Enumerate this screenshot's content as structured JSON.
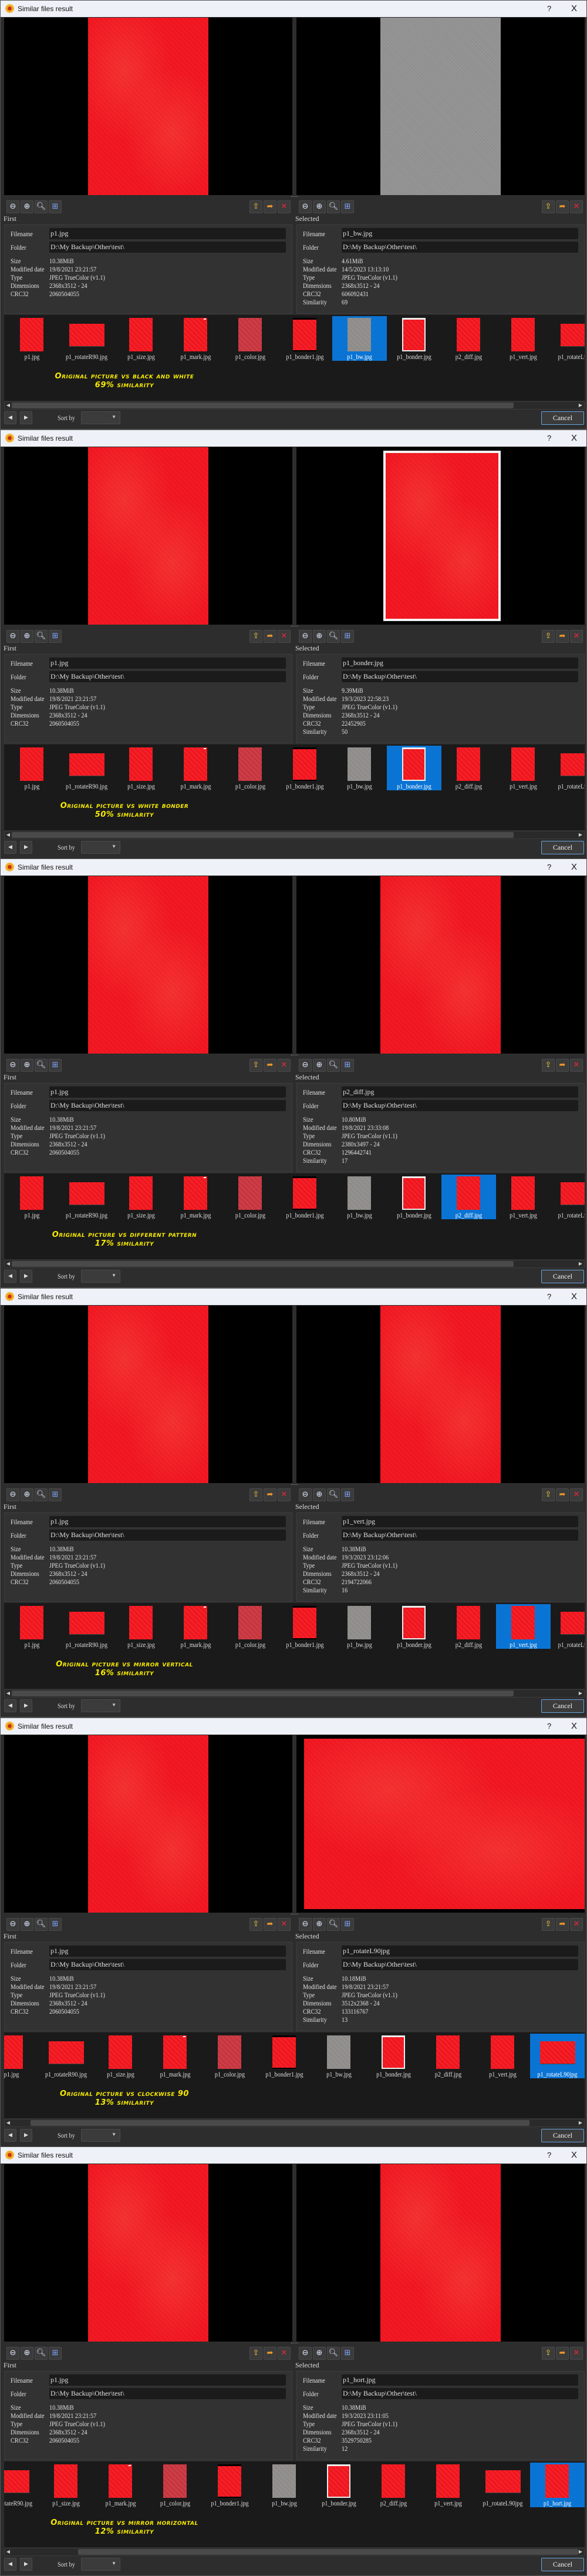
{
  "dialog": {
    "title": "Similar files result",
    "help": "?",
    "close": "X"
  },
  "labels": {
    "first": "First",
    "selected": "Selected",
    "filename": "Filename",
    "folder": "Folder",
    "size": "Size",
    "modified": "Modified date",
    "type": "Type",
    "dimensions": "Dimensions",
    "crc32": "CRC32",
    "similarity": "Similarity",
    "sort_by": "Sort by",
    "cancel": "Cancel"
  },
  "icons": {
    "left_toolbar": [
      "zoom-out-icon",
      "zoom-in-icon",
      "zoom-actual-icon",
      "fit-window-icon"
    ],
    "right_toolbar": [
      "copy-to-folder-icon",
      "move-to-folder-icon",
      "delete-icon"
    ]
  },
  "first_file": {
    "filename": "p1.jpg",
    "folder": "D:\\My Backup\\Other\\test\\",
    "size": "10.38MiB",
    "modified": "19/8/2021 23:21:57",
    "type": "JPEG TrueColor (v1.1)",
    "dimensions": "2368x3512 - 24",
    "crc32": "2060504055"
  },
  "thumbnails": [
    "p1.jpg",
    "p1_rotateR90.jpg",
    "p1_size.jpg",
    "p1_mark.jpg",
    "p1_color.jpg",
    "p1_bonder1.jpg",
    "p1_bw.jpg",
    "p1_bonder.jpg",
    "p2_diff.jpg",
    "p1_vert.jpg",
    "p1_rotateL90jpg",
    "p1_hort.jpg"
  ],
  "panels": [
    {
      "selected_index": 6,
      "selected": {
        "filename": "p1_bw.jpg",
        "folder": "D:\\My Backup\\Other\\test\\",
        "size": "4.61MiB",
        "modified": "14/5/2023 13:13:10",
        "type": "JPEG TrueColor (v1.1)",
        "dimensions": "2368x3512 - 24",
        "crc32": "606092431",
        "similarity": "69"
      },
      "caption": [
        "Original picture vs black and white",
        "69% similarity"
      ]
    },
    {
      "selected_index": 7,
      "selected": {
        "filename": "p1_bonder.jpg",
        "folder": "D:\\My Backup\\Other\\test\\",
        "size": "9.39MiB",
        "modified": "19/3/2023 22:58:23",
        "type": "JPEG TrueColor (v1.1)",
        "dimensions": "2368x3512 - 24",
        "crc32": "22452905",
        "similarity": "50"
      },
      "caption": [
        "Original picture vs white bonder",
        "50% similarity"
      ]
    },
    {
      "selected_index": 8,
      "selected": {
        "filename": "p2_diff.jpg",
        "folder": "D:\\My Backup\\Other\\test\\",
        "size": "10.80MiB",
        "modified": "19/8/2021 23:33:08",
        "type": "JPEG TrueColor (v1.1)",
        "dimensions": "2380x3497 - 24",
        "crc32": "1296442741",
        "similarity": "17"
      },
      "caption": [
        "Original picture vs different pattern",
        "17% similarity"
      ]
    },
    {
      "selected_index": 9,
      "selected": {
        "filename": "p1_vert.jpg",
        "folder": "D:\\My Backup\\Other\\test\\",
        "size": "10.38MiB",
        "modified": "19/3/2023 23:12:06",
        "type": "JPEG TrueColor (v1.1)",
        "dimensions": "2368x3512 - 24",
        "crc32": "2194722066",
        "similarity": "16"
      },
      "caption": [
        "Original picture vs mirror vertical",
        "16% similarity"
      ]
    },
    {
      "selected_index": 10,
      "selected": {
        "filename": "p1_rotateL90jpg",
        "folder": "D:\\My Backup\\Other\\test\\",
        "size": "10.18MiB",
        "modified": "19/8/2021 23:21:57",
        "type": "JPEG TrueColor (v1.1)",
        "dimensions": "3512x2368 - 24",
        "crc32": "133116767",
        "similarity": "13"
      },
      "caption": [
        "Original picture vs clockwise 90",
        "13% similarity"
      ]
    },
    {
      "selected_index": 11,
      "selected": {
        "filename": "p1_hort.jpg",
        "folder": "D:\\My Backup\\Other\\test\\",
        "size": "10.38MiB",
        "modified": "19/3/2023 23:11:05",
        "type": "JPEG TrueColor (v1.1)",
        "dimensions": "2368x3512 - 24",
        "crc32": "3529750285",
        "similarity": "12"
      },
      "caption": [
        "Original picture vs mirror horizontal",
        "12% similarity"
      ]
    }
  ]
}
